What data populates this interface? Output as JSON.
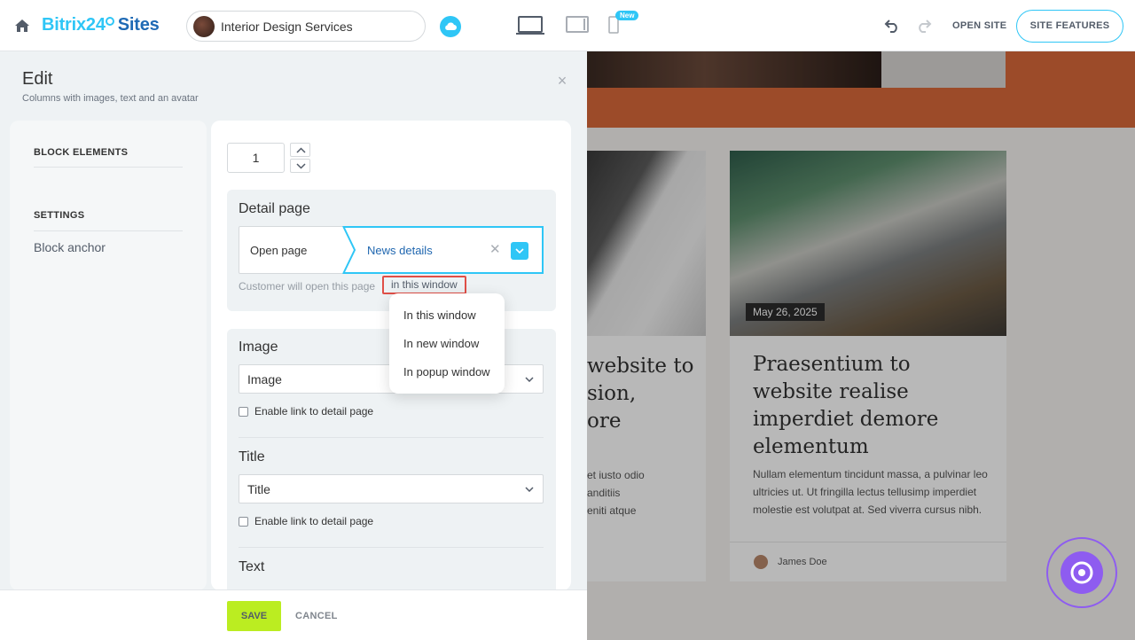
{
  "topbar": {
    "logo_brand": "Bitrix24",
    "logo_product": "Sites",
    "site_name": "Interior Design Services",
    "new_badge": "New",
    "open_site": "OPEN SITE",
    "site_features": "SITE FEATURES"
  },
  "panel": {
    "title": "Edit",
    "subtitle": "Columns with images, text and an avatar",
    "sidebar": {
      "block_elements": "BLOCK ELEMENTS",
      "settings": "SETTINGS",
      "block_anchor": "Block anchor"
    },
    "count_value": "1",
    "detail": {
      "label": "Detail page",
      "open_page_label": "Open page",
      "selected_page": "News details",
      "hint": "Customer will open this page",
      "hint_link": "in this window"
    },
    "fields": {
      "image_label": "Image",
      "image_select": "Image",
      "title_label": "Title",
      "title_select": "Title",
      "link_checkbox": "Enable link to detail page",
      "text_label": "Text"
    },
    "footer": {
      "save": "SAVE",
      "cancel": "CANCEL"
    }
  },
  "popup": {
    "items": [
      "In this window",
      "In new window",
      "In popup window"
    ]
  },
  "preview": {
    "card1_title": "website to\nsion,\nore",
    "card1_text": "et iusto odio\nanditiis\neniti atque",
    "card2_date": "May 26, 2025",
    "card2_title": "Praesentium to website realise imperdiet demore elementum",
    "card2_text": "Nullam elementum tincidunt massa, a pulvinar leo ultricies ut. Ut fringilla lectus tellusimp imperdiet molestie est volutpat at. Sed viverra cursus nibh.",
    "author": "James Doe"
  },
  "colors": {
    "accent": "#2fc6f6",
    "save": "#bbed21",
    "highlight_border": "#e04f47",
    "assistant": "#8e5cf0"
  }
}
